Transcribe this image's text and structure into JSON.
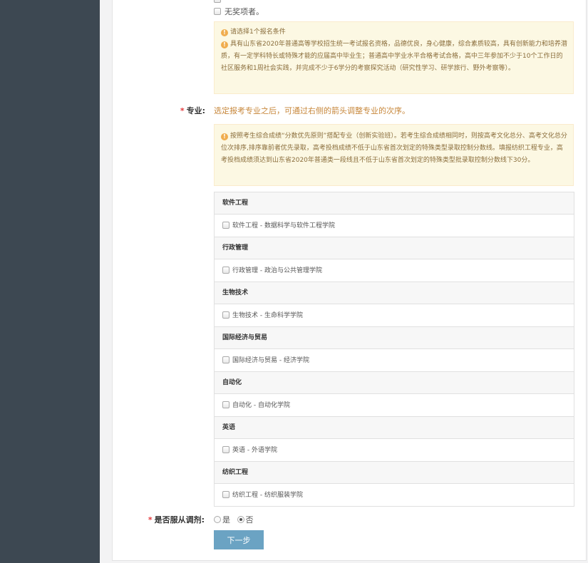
{
  "form": {
    "no_award_label": "无奖项者。",
    "condition_tip": {
      "title": "请选择1个报名条件",
      "body": "具有山东省2020年普通高等学校招生统一考试报名资格，品德优良，身心健康，综合素质较高，具有创新能力和培养潜质，有一定学科特长或特殊才能的应届高中毕业生；普通高中学业水平合格考试合格，高中三年参加不少于10个工作日的社区服务和1周社会实践，并完成不少于6学分的考察探究活动（研究性学习、研学旅行、野外考察等）。"
    },
    "major": {
      "required_mark": "*",
      "label": "专业:",
      "hint": "选定报考专业之后，可通过右侧的箭头调整专业的次序。",
      "tip": "按照考生综合成绩“分数优先原则”搭配专业（创新实验班）。若考生综合成绩相同时，则按高考文化总分、高考文化总分位次排序,排序靠前者优先录取，高考投档成绩不低于山东省首次划定的特殊类型录取控制分数线。填报纺织工程专业，高考投档成绩须达到山东省2020年普通类一段线且不低于山东省首次划定的特殊类型批录取控制分数线下30分。",
      "groups": [
        {
          "name": "软件工程",
          "option": "软件工程 - 数据科学与软件工程学院"
        },
        {
          "name": "行政管理",
          "option": "行政管理 - 政治与公共管理学院"
        },
        {
          "name": "生物技术",
          "option": "生物技术 - 生命科学学院"
        },
        {
          "name": "国际经济与贸易",
          "option": "国际经济与贸易 - 经济学院"
        },
        {
          "name": "自动化",
          "option": "自动化 - 自动化学院"
        },
        {
          "name": "英语",
          "option": "英语 - 外语学院"
        },
        {
          "name": "纺织工程",
          "option": "纺织工程 - 纺织服装学院"
        }
      ]
    },
    "adjust": {
      "required_mark": "*",
      "label": "是否服从调剂:",
      "yes": "是",
      "no": "否",
      "selected": "否"
    },
    "next_label": "下一步"
  },
  "icons": {
    "info": "info-icon",
    "info_glyph": "!"
  },
  "colors": {
    "sidebar": "#3d4852",
    "tip_bg": "#fcf8e3",
    "tip_text": "#8a6d3b",
    "required": "#e4393c",
    "hint": "#c7873b",
    "button": "#6ba3c3"
  }
}
